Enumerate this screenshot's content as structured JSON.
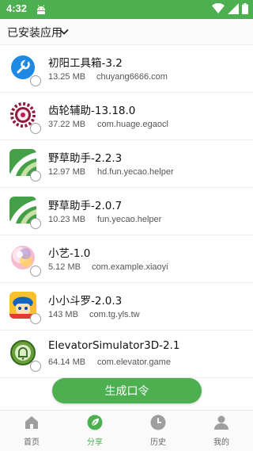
{
  "status_bar": {
    "time": "4:32"
  },
  "header": {
    "title": "已安装应用"
  },
  "apps": [
    {
      "name": "初阳工具箱-3.2",
      "size": "13.25 MB",
      "package": "chuyang6666.com",
      "icon": "wrench-icon"
    },
    {
      "name": "齿轮辅助-13.18.0",
      "size": "37.22 MB",
      "package": "com.huage.egaocl",
      "icon": "gear-icon"
    },
    {
      "name": "野草助手-2.2.3",
      "size": "12.97 MB",
      "package": "hd.fun.yecao.helper",
      "icon": "grass-icon"
    },
    {
      "name": "野草助手-2.0.7",
      "size": "10.23 MB",
      "package": "fun.yecao.helper",
      "icon": "grass-icon"
    },
    {
      "name": "小艺-1.0",
      "size": "5.12 MB",
      "package": "com.example.xiaoyi",
      "icon": "orb-icon"
    },
    {
      "name": "小小斗罗-2.0.3",
      "size": "143 MB",
      "package": "com.tg.yls.tw",
      "icon": "game-character-icon"
    },
    {
      "name": "ElevatorSimulator3D-2.1",
      "size": "64.14 MB",
      "package": "com.elevator.game",
      "icon": "bell-icon"
    }
  ],
  "generate_button": {
    "label": "生成口令"
  },
  "tabs": [
    {
      "label": "首页",
      "icon": "home-icon",
      "active": false
    },
    {
      "label": "分享",
      "icon": "leaf-icon",
      "active": true
    },
    {
      "label": "历史",
      "icon": "clock-icon",
      "active": false
    },
    {
      "label": "我的",
      "icon": "user-icon",
      "active": false
    }
  ],
  "colors": {
    "accent": "#4caf50",
    "status_bar": "#4caf50"
  }
}
